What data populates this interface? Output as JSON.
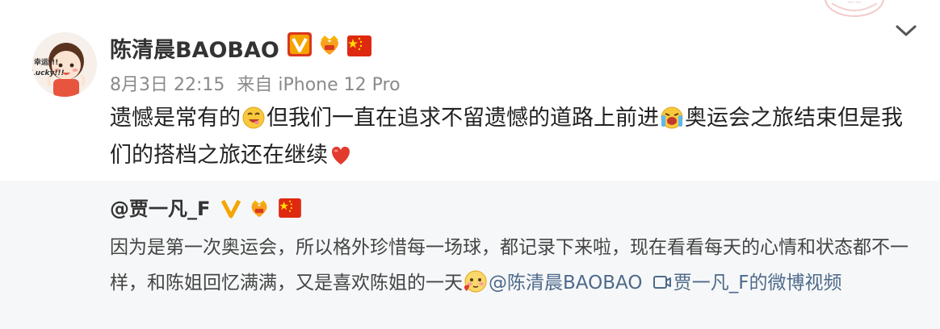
{
  "post": {
    "username": "陈清晨BAOBAO",
    "date": "8月3日 22:15",
    "source": "来自 iPhone 12 Pro",
    "text_parts": [
      "遗憾是常有的",
      "但我们一直在追求不留遗憾的道路上前进",
      "奥运会之旅结束但是我们的搭档之旅还在继续"
    ],
    "avatar_text_1": "幸运!!!",
    "avatar_text_2": "Lucky!!!"
  },
  "repost": {
    "username": "@贾一凡_F",
    "text": "因为是第一次奥运会，所以格外珍惜每一场球，都记录下来啦，现在看看每天的心情和状态都不一样，和陈姐回忆满满，又是喜欢陈姐的一天",
    "mention": "@陈清晨BAOBAO",
    "video_link": "贾一凡_F的微博视频"
  },
  "icons": [
    "avatar-illustration",
    "verified-v-icon",
    "crown-heart-icon",
    "china-flag-icon",
    "chevron-down-icon",
    "stamp-watermark",
    "grin-emoji-icon",
    "laugh-cry-emoji-icon",
    "heart-emoji-icon",
    "kiss-emoji-icon",
    "video-link-icon"
  ],
  "colors": {
    "link": "#4d6a8a",
    "verified": "#f5a400",
    "flag": "#de2910",
    "repost_bg": "#f6f7f8",
    "meta": "#8a8a8a"
  }
}
